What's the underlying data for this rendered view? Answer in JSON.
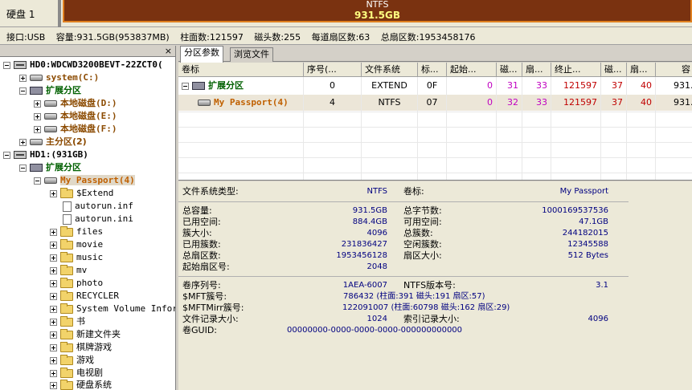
{
  "disk_bar": {
    "disk_label": "硬盘 1",
    "partition_fs": "NTFS",
    "partition_size": "931.5GB",
    "colors": {
      "partition_fill": "#7a3210",
      "partition_border": "#e08020",
      "size_text": "#ffff80"
    }
  },
  "info_bar": {
    "interface": "接口:USB",
    "capacity": "容量:931.5GB(953837MB)",
    "cylinders": "柱面数:121597",
    "heads": "磁头数:255",
    "sectors_per_track": "每道扇区数:63",
    "total_sectors": "总扇区数:1953458176"
  },
  "tree": {
    "close_glyph": "×",
    "nodes": [
      {
        "label": "HD0:WDCWD3200BEVT-22ZCT0(",
        "icon": "disk-icon"
      },
      {
        "label": "system(C:)",
        "icon": "drive-icon"
      },
      {
        "label": "扩展分区",
        "icon": "extended-partition-icon"
      },
      {
        "label": "本地磁盘(D:)",
        "icon": "drive-icon"
      },
      {
        "label": "本地磁盘(E:)",
        "icon": "drive-icon"
      },
      {
        "label": "本地磁盘(F:)",
        "icon": "drive-icon"
      },
      {
        "label": "主分区(2)",
        "icon": "drive-icon"
      },
      {
        "label": "HD1:(931GB)",
        "icon": "disk-icon"
      },
      {
        "label": "扩展分区",
        "icon": "extended-partition-icon"
      },
      {
        "label": "My Passport(4)",
        "icon": "drive-icon"
      },
      {
        "label": "$Extend",
        "icon": "folder-icon"
      },
      {
        "label": "autorun.inf",
        "icon": "file-icon"
      },
      {
        "label": "autorun.ini",
        "icon": "file-icon"
      },
      {
        "label": "files",
        "icon": "folder-icon"
      },
      {
        "label": "movie",
        "icon": "folder-icon"
      },
      {
        "label": "music",
        "icon": "folder-icon"
      },
      {
        "label": "mv",
        "icon": "folder-icon"
      },
      {
        "label": "photo",
        "icon": "folder-icon"
      },
      {
        "label": "RECYCLER",
        "icon": "folder-icon"
      },
      {
        "label": "System Volume Inform",
        "icon": "folder-icon"
      },
      {
        "label": "书",
        "icon": "folder-icon"
      },
      {
        "label": "新建文件夹",
        "icon": "folder-icon"
      },
      {
        "label": "棋牌游戏",
        "icon": "folder-icon"
      },
      {
        "label": "游戏",
        "icon": "folder-icon"
      },
      {
        "label": "电视剧",
        "icon": "folder-icon"
      },
      {
        "label": "硬盘系统",
        "icon": "folder-icon"
      }
    ]
  },
  "tabs": [
    "分区参数",
    "浏览文件"
  ],
  "grid": {
    "headers": [
      "卷标",
      "序号(...",
      "文件系统",
      "标...",
      "起始...",
      "磁...",
      "扇...",
      "终止...",
      "磁...",
      "扇...",
      "容"
    ],
    "rows": [
      {
        "label": "扩展分区",
        "seq": "0",
        "fs": "EXTEND",
        "flag": "0F",
        "start_cyl": "0",
        "start_head": "31",
        "start_sec": "33",
        "end_cyl": "121597",
        "end_head": "37",
        "end_sec": "40",
        "cap": "931."
      },
      {
        "label": "My Passport(4)",
        "seq": "4",
        "fs": "NTFS",
        "flag": "07",
        "start_cyl": "0",
        "start_head": "32",
        "start_sec": "33",
        "end_cyl": "121597",
        "end_head": "37",
        "end_sec": "40",
        "cap": "931."
      }
    ]
  },
  "details": {
    "fs_type_label": "文件系统类型:",
    "fs_type": "NTFS",
    "volume_label_label": "卷标:",
    "volume_label": "My Passport",
    "total_cap_label": "总容量:",
    "total_cap": "931.5GB",
    "total_bytes_label": "总字节数:",
    "total_bytes": "1000169537536",
    "used_label": "已用空间:",
    "used": "884.4GB",
    "free_label": "可用空间:",
    "free": "47.1GB",
    "cluster_size_label": "簇大小:",
    "cluster_size": "4096",
    "total_clusters_label": "总簇数:",
    "total_clusters": "244182015",
    "used_clusters_label": "已用簇数:",
    "used_clusters": "231836427",
    "free_clusters_label": "空闲簇数:",
    "free_clusters": "12345588",
    "total_sectors_label": "总扇区数:",
    "total_sectors": "1953456128",
    "sector_size_label": "扇区大小:",
    "sector_size": "512 Bytes",
    "start_sector_label": "起始扇区号:",
    "start_sector": "2048",
    "serial_label": "卷序列号:",
    "serial": "1AEA-6007",
    "ntfs_ver_label": "NTFS版本号:",
    "ntfs_ver": "3.1",
    "mft_label": "$MFT簇号:",
    "mft": "786432 (柱面:391 磁头:191 扇区:57)",
    "mftmirr_label": "$MFTMirr簇号:",
    "mftmirr": "122091007 (柱面:60798 磁头:162 扇区:29)",
    "record_size_label": "文件记录大小:",
    "record_size": "1024",
    "index_size_label": "索引记录大小:",
    "index_size": "4096",
    "guid_label": "卷GUID:",
    "guid": "00000000-0000-0000-0000-000000000000"
  }
}
